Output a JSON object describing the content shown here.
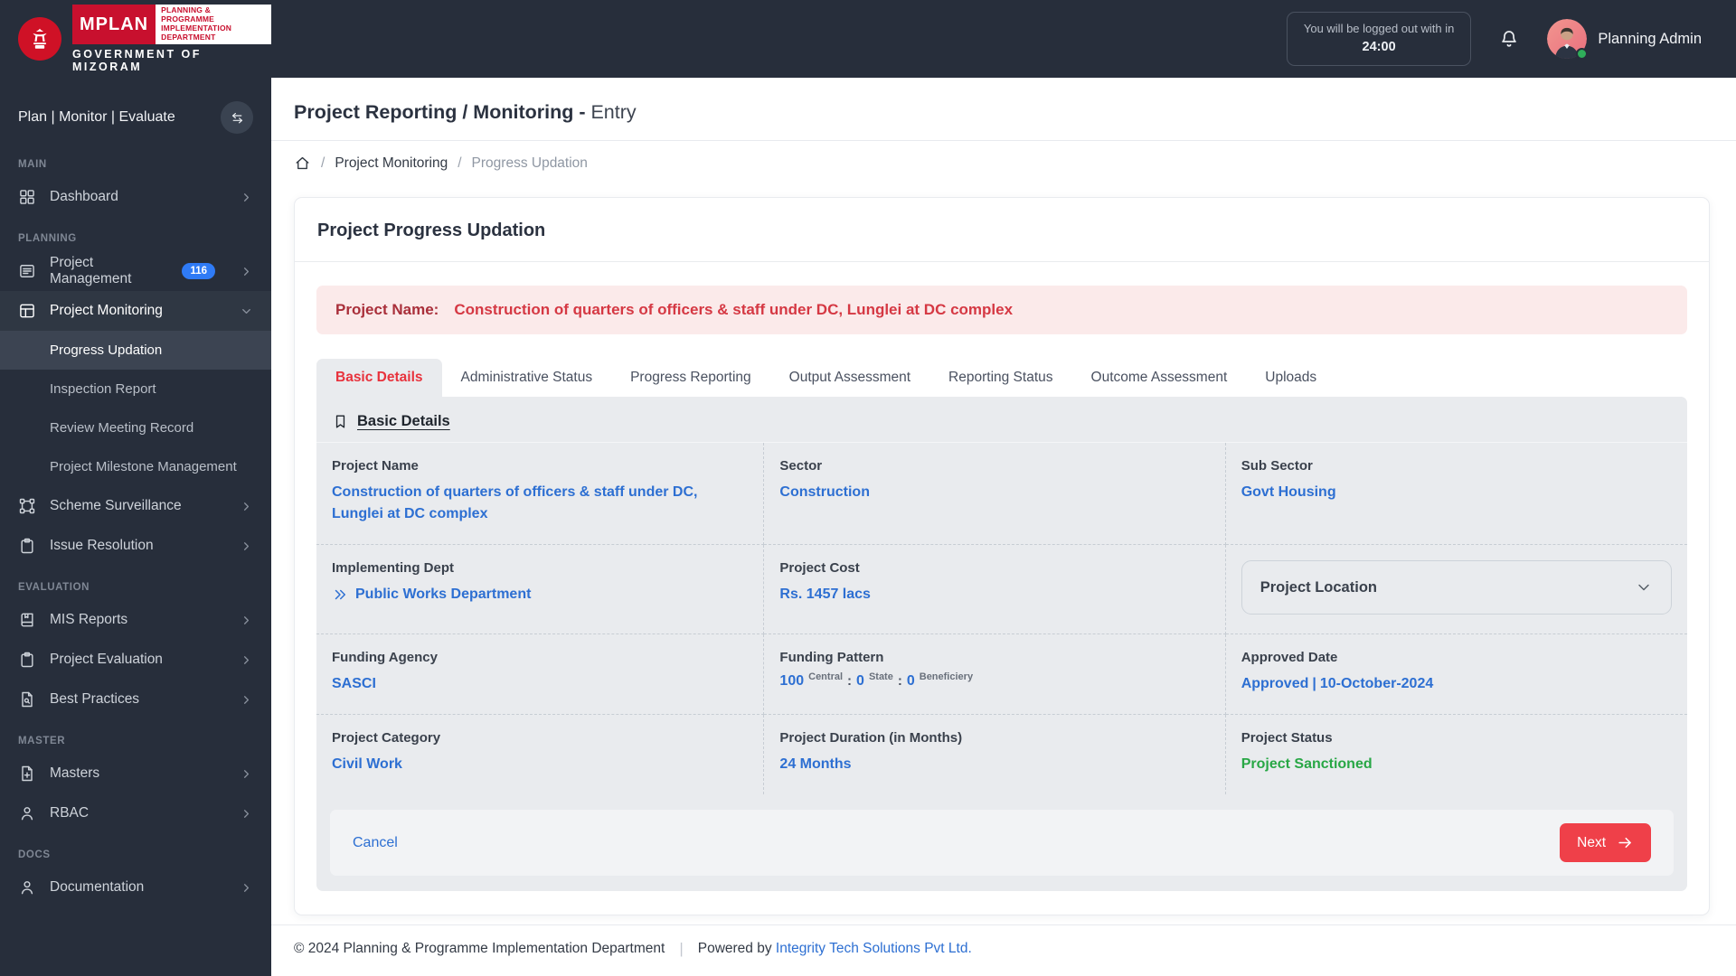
{
  "colors": {
    "sidebar_bg": "#272e3b",
    "brand_red": "#c8102e",
    "accent_red": "#ef4049",
    "tab_active_red": "#e8323c",
    "link_blue": "#2d6fd2",
    "badge_blue": "#2f7bf6",
    "status_green": "#28a745",
    "banner_bg": "#fbeaea"
  },
  "brand": {
    "app_name": "MPLAN",
    "dept_line1": "PLANNING & PROGRAMME",
    "dept_line2": "IMPLEMENTATION DEPARTMENT",
    "government": "GOVERNMENT OF MIZORAM"
  },
  "header": {
    "logout_notice": "You will be logged out with in",
    "logout_timer": "24:00",
    "user_name": "Planning Admin"
  },
  "sidebar": {
    "tagline": "Plan | Monitor | Evaluate",
    "sections": [
      {
        "label": "MAIN",
        "items": [
          {
            "label": "Dashboard"
          }
        ]
      },
      {
        "label": "PLANNING",
        "items": [
          {
            "label": "Project Management",
            "badge": "116"
          },
          {
            "label": "Project Monitoring",
            "children": [
              {
                "label": "Progress Updation"
              },
              {
                "label": "Inspection Report"
              },
              {
                "label": "Review Meeting Record"
              },
              {
                "label": "Project Milestone Management"
              }
            ]
          },
          {
            "label": "Scheme Surveillance"
          },
          {
            "label": "Issue Resolution"
          }
        ]
      },
      {
        "label": "EVALUATION",
        "items": [
          {
            "label": "MIS Reports"
          },
          {
            "label": "Project Evaluation"
          },
          {
            "label": "Best Practices"
          }
        ]
      },
      {
        "label": "MASTER",
        "items": [
          {
            "label": "Masters"
          },
          {
            "label": "RBAC"
          }
        ]
      },
      {
        "label": "DOCS",
        "items": [
          {
            "label": "Documentation"
          }
        ]
      }
    ]
  },
  "page": {
    "title_main": "Project Reporting / Monitoring -",
    "title_sub": "Entry",
    "breadcrumb": [
      "Project Monitoring",
      "Progress Updation"
    ]
  },
  "card": {
    "title": "Project Progress Updation",
    "banner": {
      "label": "Project Name:",
      "value": "Construction of quarters of officers & staff under DC, Lunglei at DC complex"
    },
    "tabs": [
      "Basic Details",
      "Administrative Status",
      "Progress Reporting",
      "Output Assessment",
      "Reporting Status",
      "Outcome Assessment",
      "Uploads"
    ],
    "section_title": "Basic Details",
    "fields": {
      "project_name": {
        "label": "Project Name",
        "value": "Construction of quarters of officers & staff under DC, Lunglei at DC complex"
      },
      "sector": {
        "label": "Sector",
        "value": "Construction"
      },
      "sub_sector": {
        "label": "Sub Sector",
        "value": "Govt Housing"
      },
      "implementing_dept": {
        "label": "Implementing Dept",
        "value": "Public Works Department"
      },
      "project_cost": {
        "label": "Project Cost",
        "value": "Rs. 1457 lacs"
      },
      "project_location": {
        "label": "Project Location"
      },
      "funding_agency": {
        "label": "Funding Agency",
        "value": "SASCI"
      },
      "funding_pattern": {
        "label": "Funding Pattern",
        "central_value": "100",
        "central_label": "Central",
        "state_value": "0",
        "state_label": "State",
        "beneficiary_value": "0",
        "beneficiary_label": "Beneficiery",
        "colon": ":"
      },
      "approved_date": {
        "label": "Approved Date",
        "status": "Approved",
        "sep": "|",
        "date": "10-October-2024"
      },
      "project_category": {
        "label": "Project Category",
        "value": "Civil Work"
      },
      "project_duration": {
        "label": "Project Duration (in Months)",
        "value": "24 Months"
      },
      "project_status": {
        "label": "Project Status",
        "value": "Project Sanctioned"
      }
    },
    "actions": {
      "cancel": "Cancel",
      "next": "Next"
    }
  },
  "footer": {
    "copyright": "© 2024 Planning & Programme Implementation Department",
    "divider": "|",
    "powered_prefix": "Powered by",
    "powered_link": "Integrity Tech Solutions Pvt Ltd."
  }
}
